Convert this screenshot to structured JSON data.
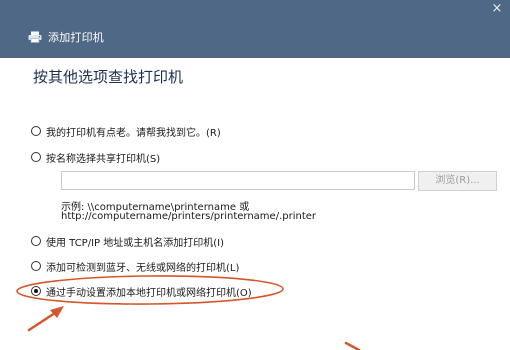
{
  "window": {
    "title": "添加打印机",
    "close_glyph": "×"
  },
  "heading": "按其他选项查找打印机",
  "options": [
    {
      "label": "我的打印机有点老。请帮我找到它。(R)",
      "selected": false
    },
    {
      "label": "按名称选择共享打印机(S)",
      "selected": false
    },
    {
      "label": "使用 TCP/IP 地址或主机名添加打印机(I)",
      "selected": false
    },
    {
      "label": "添加可检测到蓝牙、无线或网络的打印机(L)",
      "selected": false
    },
    {
      "label": "通过手动设置添加本地打印机或网络打印机(O)",
      "selected": true
    }
  ],
  "share_name": {
    "value": "",
    "browse_label": "浏览(R)...",
    "example_line1": "示例: \\\\computername\\printername 或",
    "example_line2": "http://computername/printers/printername/.printer"
  },
  "colors": {
    "titlebar": "#4f6885",
    "heading": "#1e3050",
    "annotation": "#d4572b"
  },
  "icons": {
    "title_icon": "printer-icon",
    "close_icon": "close-icon"
  }
}
